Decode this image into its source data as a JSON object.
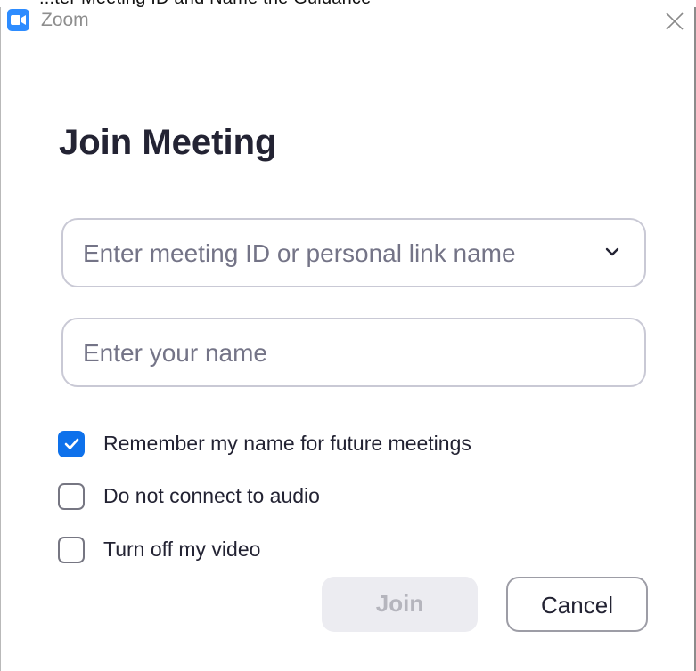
{
  "window": {
    "title": "Zoom",
    "background_overlap_text": "...ter Meeting ID and Name the Guidance"
  },
  "dialog": {
    "heading": "Join Meeting",
    "meeting_id": {
      "value": "",
      "placeholder": "Enter meeting ID or personal link name"
    },
    "name": {
      "value": "",
      "placeholder": "Enter your name"
    },
    "options": [
      {
        "label": "Remember my name for future meetings",
        "checked": true
      },
      {
        "label": "Do not connect to audio",
        "checked": false
      },
      {
        "label": "Turn off my video",
        "checked": false
      }
    ],
    "join_label": "Join",
    "cancel_label": "Cancel"
  },
  "colors": {
    "accent": "#0e71eb",
    "brand": "#2d8cff",
    "join_disabled_bg": "#ececf1",
    "join_disabled_text": "#b5b5bd"
  },
  "icons": {
    "app": "zoom-camera-icon",
    "close": "close-icon",
    "dropdown": "chevron-down-icon",
    "check": "checkmark-icon"
  }
}
